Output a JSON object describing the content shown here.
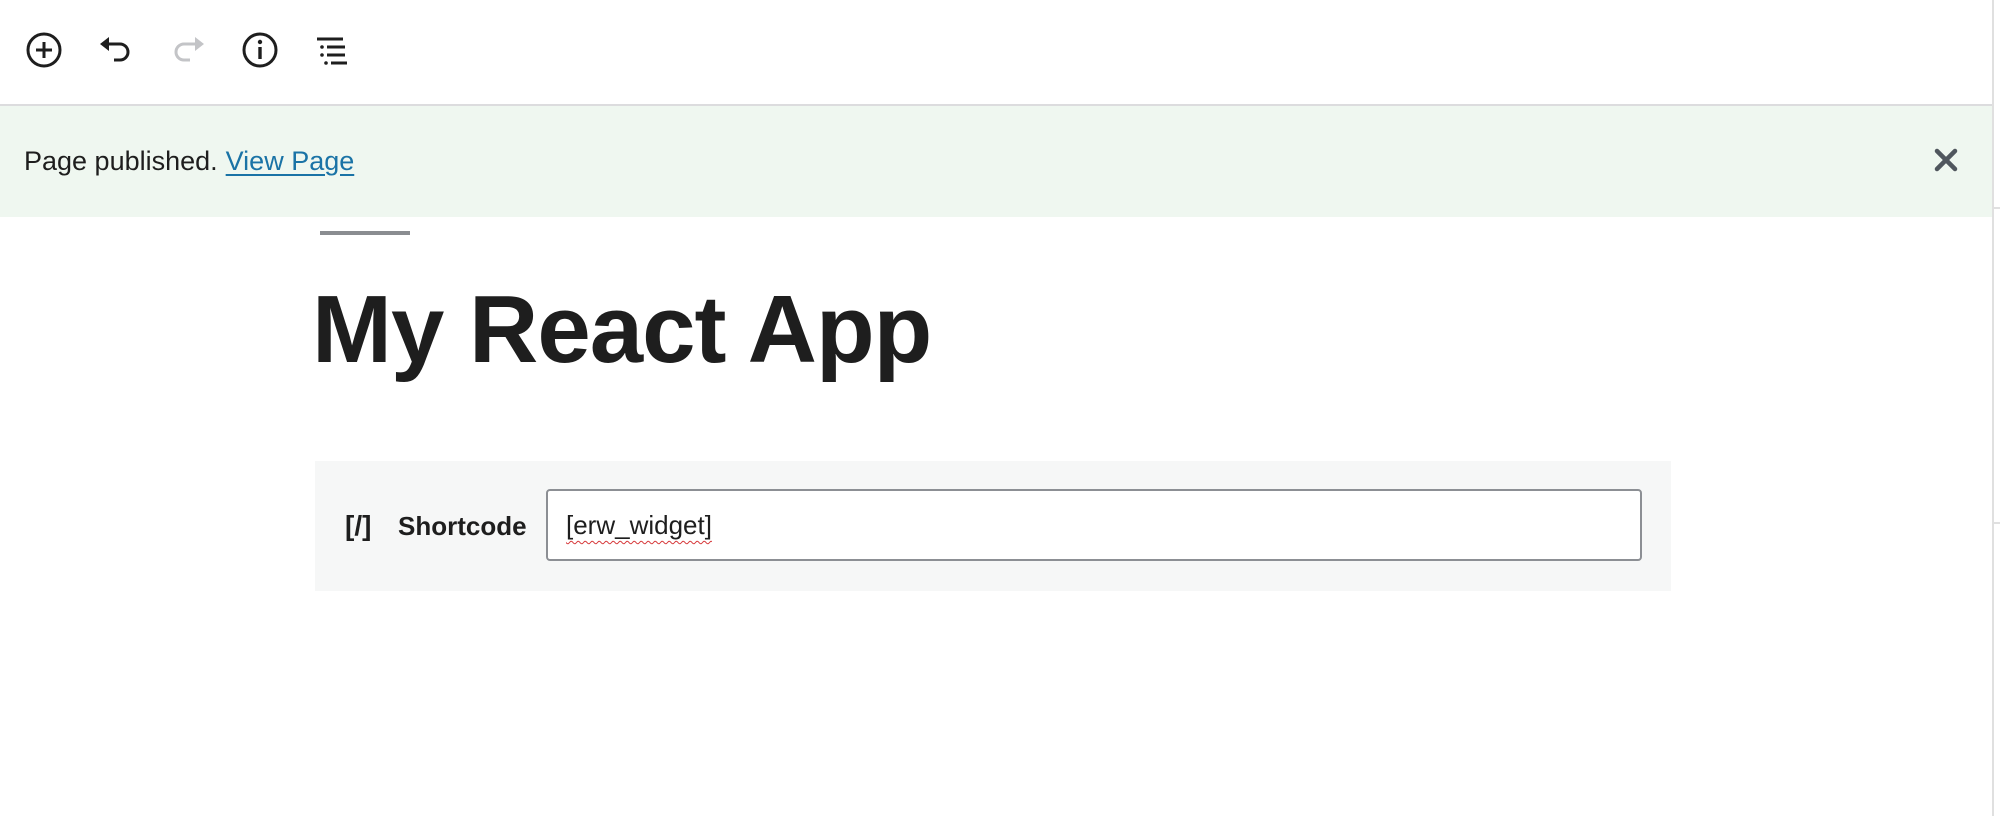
{
  "toolbar": {
    "buttons": [
      {
        "name": "add-block",
        "icon": "plus-circle-icon"
      },
      {
        "name": "undo",
        "icon": "undo-icon"
      },
      {
        "name": "redo",
        "icon": "redo-icon",
        "disabled": true
      },
      {
        "name": "details",
        "icon": "info-icon"
      },
      {
        "name": "outline",
        "icon": "list-outline-icon"
      }
    ]
  },
  "notice": {
    "message": "Page published.",
    "link_label": "View Page",
    "close_icon": "close-icon",
    "background": "#eff7f0",
    "link_color": "#1a73a6"
  },
  "page": {
    "title": "My React App"
  },
  "shortcode_block": {
    "icon_text": "[/]",
    "label": "Shortcode",
    "value": "[erw_widget]"
  }
}
